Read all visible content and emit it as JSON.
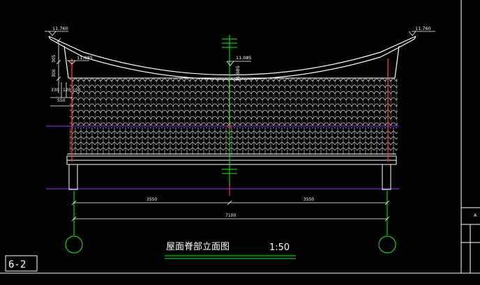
{
  "drawing": {
    "title": "屋面脊部立面图",
    "scale": "1:50",
    "sheet_number": "6-2",
    "edge_mark": "A"
  },
  "levels": {
    "left_top": "11.760",
    "right_top": "11.760",
    "ridge": "11.085",
    "left_eave": "11.085",
    "ridge_vertical": "11.085"
  },
  "dimensions": {
    "left_half": "3550",
    "right_half": "3550",
    "total": "7100",
    "side_305": "305",
    "side_300": "300",
    "side_330": "330",
    "side_120": "120",
    "side_100": "100",
    "side_550": "550"
  },
  "colors": {
    "background": "#000000",
    "lines": "#ffffff",
    "axis": "#00ff00",
    "column": "#ff3030",
    "purlin": "#9b30ff",
    "tiles": "#e0e0e0"
  }
}
